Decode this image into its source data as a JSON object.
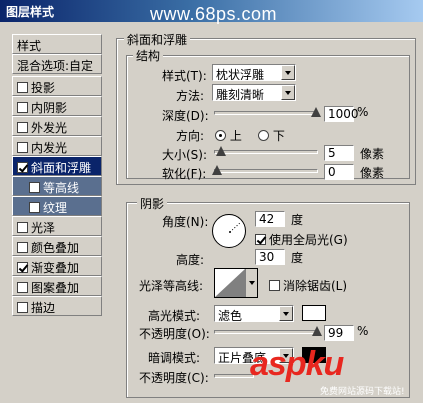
{
  "window": {
    "title": "图层样式",
    "watermark": "www.68ps.com"
  },
  "left_pane": {
    "header": "样式",
    "blend": "混合选项:自定",
    "items": [
      {
        "label": "投影",
        "checked": false
      },
      {
        "label": "内阴影",
        "checked": false
      },
      {
        "label": "外发光",
        "checked": false
      },
      {
        "label": "内发光",
        "checked": false
      },
      {
        "label": "斜面和浮雕",
        "checked": true
      },
      {
        "label": "等高线",
        "checked": false
      },
      {
        "label": "纹理",
        "checked": false
      },
      {
        "label": "光泽",
        "checked": false
      },
      {
        "label": "颜色叠加",
        "checked": false
      },
      {
        "label": "渐变叠加",
        "checked": true
      },
      {
        "label": "图案叠加",
        "checked": false
      },
      {
        "label": "描边",
        "checked": false
      }
    ]
  },
  "bevel": {
    "group_title": "斜面和浮雕",
    "structure_title": "结构",
    "style_label": "样式(T):",
    "style_value": "枕状浮雕",
    "technique_label": "方法:",
    "technique_value": "雕刻清晰",
    "depth_label": "深度(D):",
    "depth_value": "1000",
    "depth_unit": "%",
    "direction_label": "方向:",
    "direction_up": "上",
    "direction_down": "下",
    "size_label": "大小(S):",
    "size_value": "5",
    "size_unit": "像素",
    "soften_label": "软化(F):",
    "soften_value": "0",
    "soften_unit": "像素"
  },
  "shading": {
    "title": "阴影",
    "angle_label": "角度(N):",
    "angle_value": "42",
    "angle_unit": "度",
    "global_light_label": "使用全局光(G)",
    "altitude_label": "高度:",
    "altitude_value": "30",
    "altitude_unit": "度",
    "gloss_label": "光泽等高线:",
    "antialias_label": "消除锯齿(L)",
    "highlight_mode_label": "高光模式:",
    "highlight_mode_value": "滤色",
    "highlight_opacity_label": "不透明度(O):",
    "highlight_opacity_value": "99",
    "highlight_opacity_unit": "%",
    "shadow_mode_label": "暗调模式:",
    "shadow_mode_value": "正片叠底",
    "shadow_opacity_label": "不透明度(C):",
    "highlight_color": "#ffffff",
    "shadow_color": "#000000"
  },
  "footer_logo": {
    "main": "aspku",
    "sub": "免费网站源码下载站!"
  }
}
